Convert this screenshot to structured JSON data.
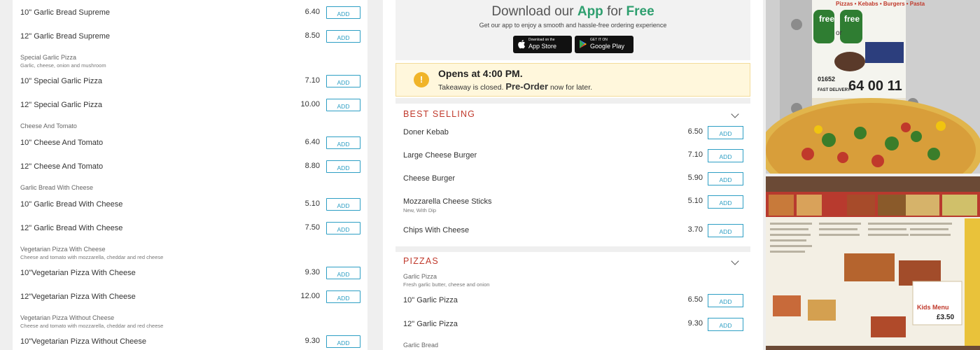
{
  "left_menu": {
    "add_label": "ADD",
    "groups": [
      {
        "label": "",
        "desc": "",
        "items": [
          {
            "name": "10\" Garlic Bread Supreme",
            "price": "6.40"
          },
          {
            "name": "12\" Garlic Bread Supreme",
            "price": "8.50"
          }
        ]
      },
      {
        "label": "Special Garlic Pizza",
        "desc": "Garlic, cheese, onion and mushroom",
        "items": [
          {
            "name": "10\" Special Garlic Pizza",
            "price": "7.10"
          },
          {
            "name": "12\" Special Garlic Pizza",
            "price": "10.00"
          }
        ]
      },
      {
        "label": "Cheese And Tomato",
        "desc": "",
        "items": [
          {
            "name": "10\" Cheese And Tomato",
            "price": "6.40"
          },
          {
            "name": "12\" Cheese And Tomato",
            "price": "8.80"
          }
        ]
      },
      {
        "label": "Garlic Bread With Cheese",
        "desc": "",
        "items": [
          {
            "name": "10\" Garlic Bread With Cheese",
            "price": "5.10"
          },
          {
            "name": "12\" Garlic Bread With Cheese",
            "price": "7.50"
          }
        ]
      },
      {
        "label": "Vegetarian Pizza With Cheese",
        "desc": "Cheese and tomato with mozzarella, cheddar and red cheese",
        "items": [
          {
            "name": "10\"Vegetarian Pizza With Cheese",
            "price": "9.30"
          },
          {
            "name": "12\"Vegetarian Pizza With Cheese",
            "price": "12.00"
          }
        ]
      },
      {
        "label": "Vegetarian Pizza Without Cheese",
        "desc": "Cheese and tomato with mozzarella, cheddar and red cheese",
        "items": [
          {
            "name": "10\"Vegetarian Pizza Without Cheese",
            "price": "9.30"
          }
        ]
      }
    ]
  },
  "app_promo": {
    "title_prefix": "Download our",
    "title_app": "App",
    "title_mid": "for",
    "title_free": "Free",
    "subtitle": "Get our app to enjoy a smooth and hassle-free ordering experience",
    "appstore_small": "Download on the",
    "appstore_big": "App Store",
    "googleplay_small": "GET IT ON",
    "googleplay_big": "Google Play"
  },
  "notice": {
    "title": "Opens at 4:00 PM.",
    "text_prefix": "Takeaway is closed.",
    "preorder": "Pre-Order",
    "text_suffix": "now for later."
  },
  "best_selling": {
    "heading": "BEST SELLING",
    "add_label": "ADD",
    "items": [
      {
        "name": "Doner Kebab",
        "desc": "",
        "price": "6.50"
      },
      {
        "name": "Large Cheese Burger",
        "desc": "",
        "price": "7.10"
      },
      {
        "name": "Cheese Burger",
        "desc": "",
        "price": "5.90"
      },
      {
        "name": "Mozzarella Cheese Sticks",
        "desc": "New, With Dip",
        "price": "5.10"
      },
      {
        "name": "Chips With Cheese",
        "desc": "",
        "price": "3.70"
      }
    ]
  },
  "pizzas": {
    "heading": "PIZZAS",
    "add_label": "ADD",
    "group_label": "Garlic Pizza",
    "group_desc": "Fresh garlic butter, cheese and onion",
    "items": [
      {
        "name": "10\" Garlic Pizza",
        "price": "6.50"
      },
      {
        "name": "12\" Garlic Pizza",
        "price": "9.30"
      }
    ],
    "next_label": "Garlic Bread"
  },
  "photo_flyer": {
    "top_text": "Pizzas • Kebabs • Burgers • Pasta",
    "free1": "free",
    "or": "or",
    "free2": "free",
    "code": "01652",
    "phone": "64 00 11",
    "delivery": "FAST DELIVERY"
  },
  "photo_menu": {
    "kids_menu": "Kids Menu",
    "kids_price": "£3.50"
  },
  "colors": {
    "accent_blue": "#2e9fc4",
    "heading_red": "#c0392b",
    "app_green": "#2e9f6f",
    "notice_bg": "#fff7dc"
  }
}
